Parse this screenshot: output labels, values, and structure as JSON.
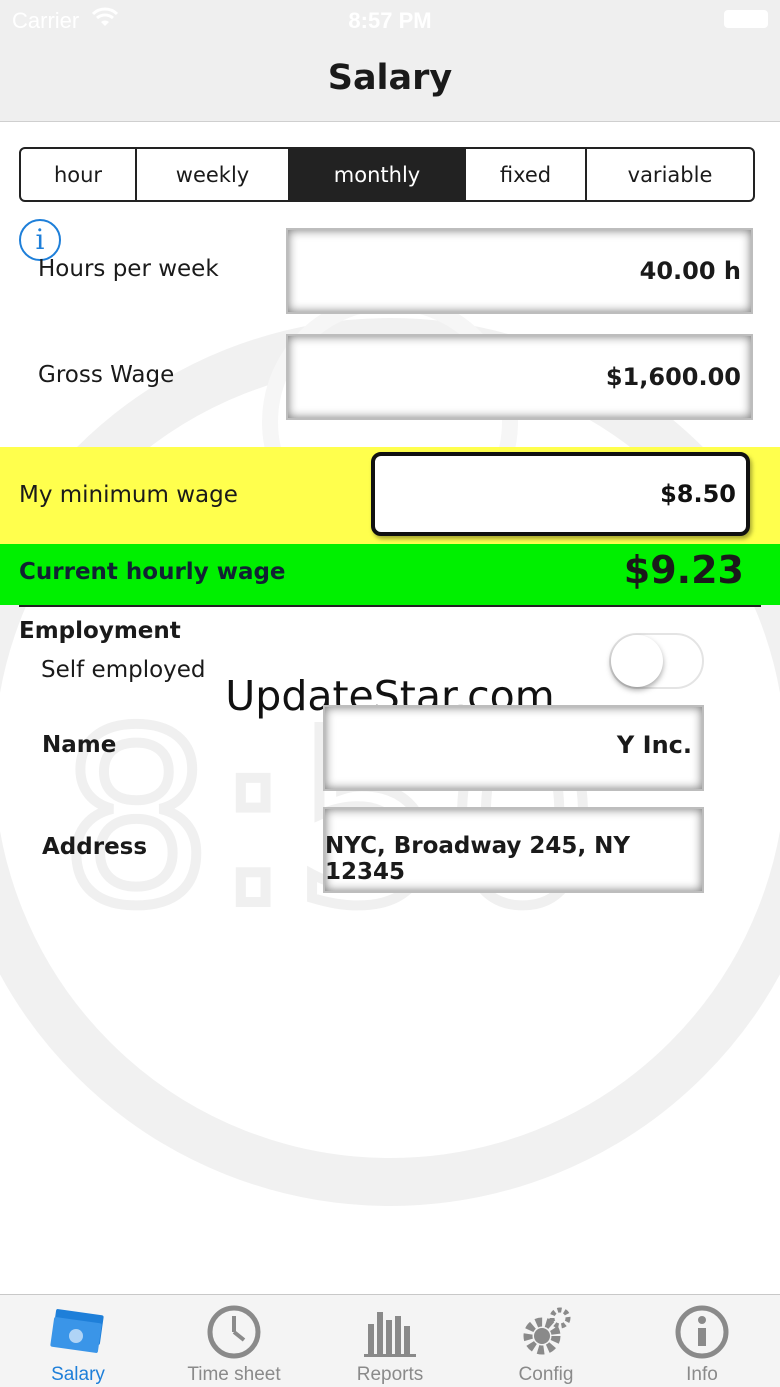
{
  "status_bar": {
    "carrier": "Carrier",
    "time": "8:57 PM"
  },
  "navbar": {
    "title": "Salary"
  },
  "segments": {
    "items": [
      "hour",
      "weekly",
      "monthly",
      "fixed",
      "variable"
    ],
    "selected": "monthly"
  },
  "form": {
    "hours_label": "Hours per week",
    "hours_value": "40.00 h",
    "gross_label": "Gross Wage",
    "gross_value": "$1,600.00",
    "minwage_label": "My minimum wage",
    "minwage_value": "$8.50",
    "current_label": "Current hourly wage",
    "current_value": "$9.23"
  },
  "employment": {
    "section_label": "Employment",
    "self_employed_label": "Self employed",
    "self_employed_on": false,
    "name_label": "Name",
    "name_value": "Y Inc.",
    "address_label": "Address",
    "address_value": "NYC, Broadway 245, NY 12345"
  },
  "watermark": "UpdateStar.com",
  "colors": {
    "accent": "#1e7fd9",
    "highlight_yellow": "#ffff4d",
    "highlight_green": "#00f000",
    "segment_active": "#222222"
  },
  "tabbar": {
    "items": [
      {
        "label": "Salary",
        "icon": "money-icon",
        "active": true
      },
      {
        "label": "Time sheet",
        "icon": "clock-icon",
        "active": false
      },
      {
        "label": "Reports",
        "icon": "bar-chart-icon",
        "active": false
      },
      {
        "label": "Config",
        "icon": "gear-icon",
        "active": false
      },
      {
        "label": "Info",
        "icon": "info-icon",
        "active": false
      }
    ]
  }
}
